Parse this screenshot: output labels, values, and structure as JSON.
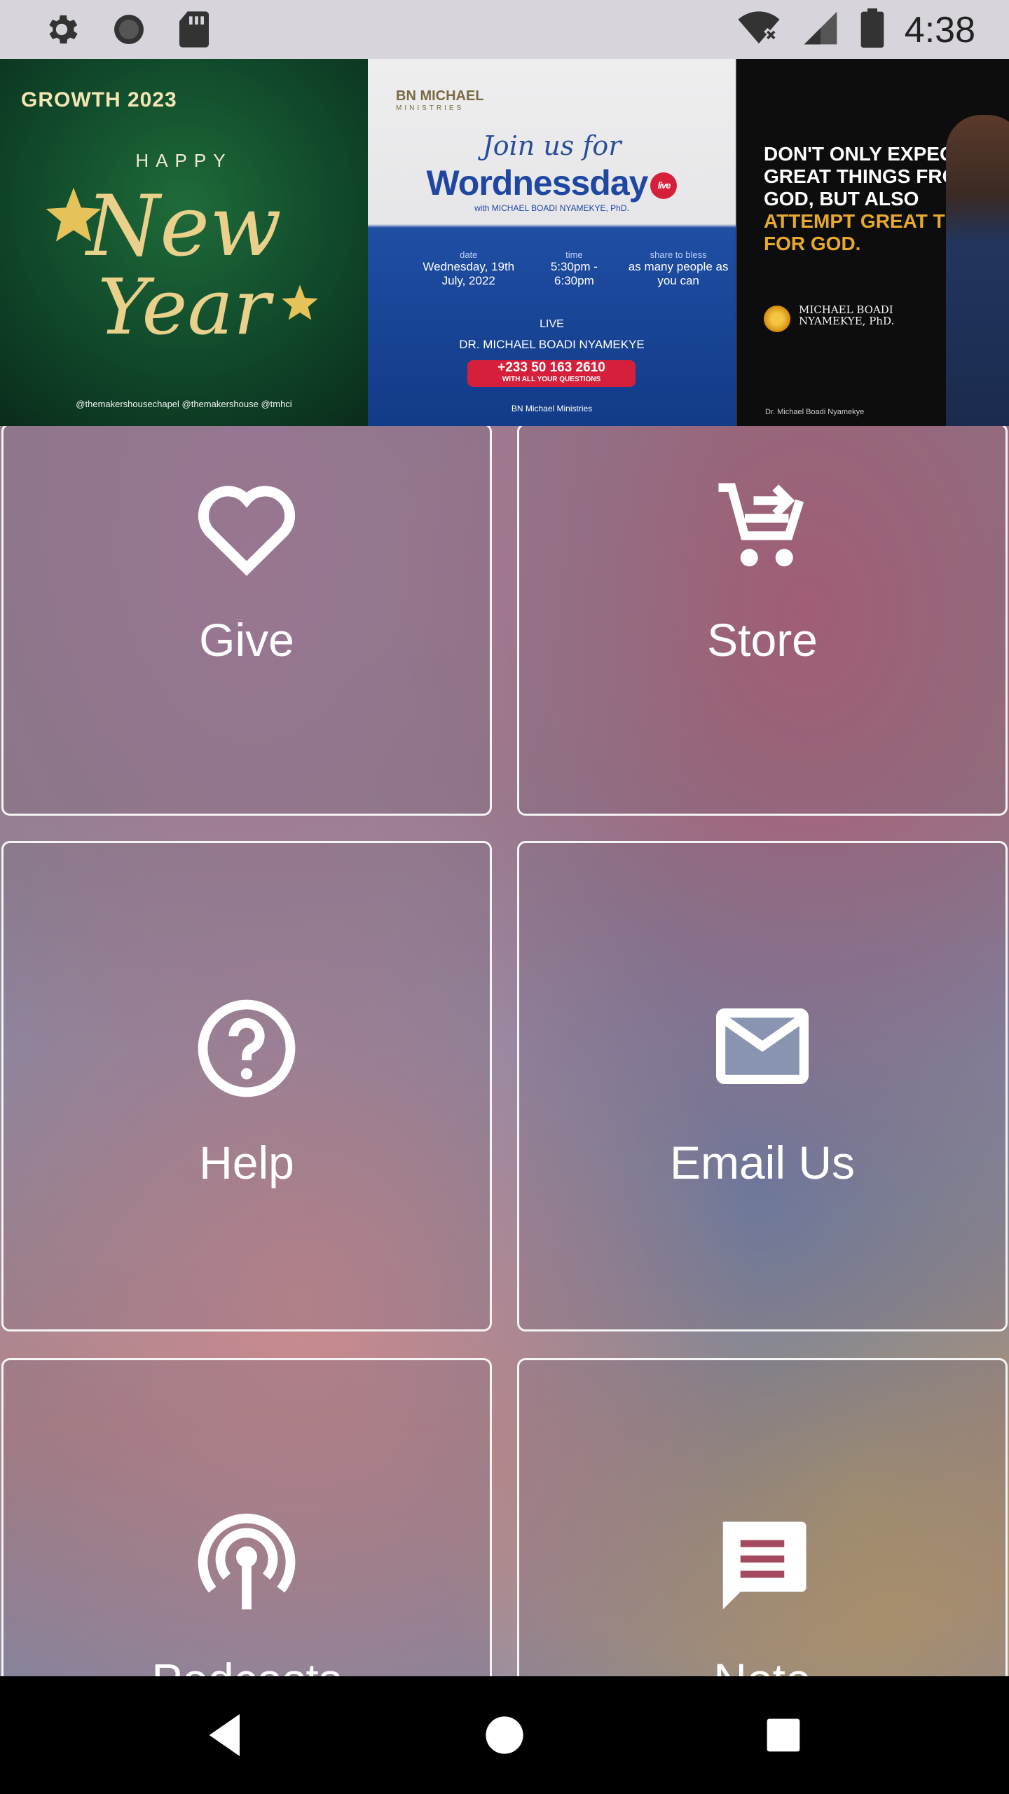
{
  "status_bar": {
    "time": "4:38",
    "left_icons": [
      "gear-icon",
      "circle-icon",
      "sd-card-icon"
    ],
    "right_icons": [
      "wifi-off-icon",
      "signal-icon",
      "battery-icon"
    ]
  },
  "banner": {
    "slide1": {
      "brand": "GROWTH 2023",
      "happy": "HAPPY",
      "script_line1": "New",
      "script_line2": "Year",
      "socials": "@themakershousechapel   @themakershouse   @tmhci"
    },
    "slide2": {
      "org": "BN MICHAEL",
      "org_sub": "MINISTRIES",
      "join": "Join us for",
      "title": "Wordnessday",
      "live": "live",
      "with": "with MICHAEL BOADI NYAMEKYE, PhD.",
      "date_label": "date",
      "date_value": "Wednesday, 19th July, 2022",
      "time_label": "time",
      "time_value": "5:30pm - 6:30pm",
      "share_label": "share to bless",
      "share_value": "as many people as you can",
      "fb_live": "LIVE",
      "name": "DR. MICHAEL BOADI NYAMEKYE",
      "phone": "+233 50 163 2610",
      "phone_sub": "WITH ALL YOUR QUESTIONS",
      "footer": "BN Michael Ministries"
    },
    "slide3": {
      "quote_white": "DON'T ONLY EXPECT GREAT THINGS FROM GOD, BUT ALSO",
      "quote_gold": "ATTEMPT GREAT THINGS FOR GOD.",
      "author_line1": "MICHAEL BOADI",
      "author_line2": "NYAMEKYE, PhD.",
      "footer": "Dr. Michael Boadi Nyamekye"
    }
  },
  "tiles": [
    {
      "label": "Give",
      "icon": "heart-icon"
    },
    {
      "label": "Store",
      "icon": "cart-icon"
    },
    {
      "label": "Help",
      "icon": "help-icon"
    },
    {
      "label": "Email Us",
      "icon": "email-icon"
    },
    {
      "label": "Podcasts",
      "icon": "podcast-icon"
    },
    {
      "label": "Note",
      "icon": "note-icon"
    }
  ],
  "nav": [
    "back-icon",
    "home-icon",
    "recents-icon"
  ]
}
